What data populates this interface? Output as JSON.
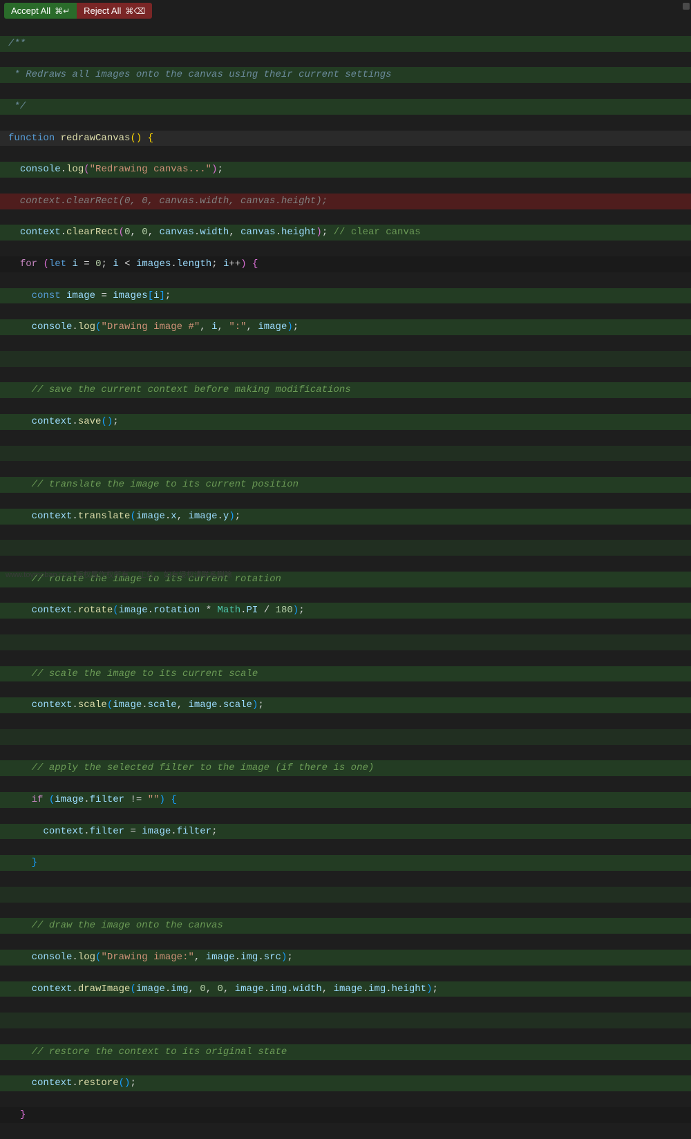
{
  "toolbar": {
    "accept_label": "Accept All",
    "accept_shortcut": "⌘↵",
    "reject_label": "Reject All",
    "reject_shortcut": "⌘⌫"
  },
  "code": {
    "l1": "/**",
    "l2": " * Redraws all images onto the canvas using their current settings",
    "l3": " */",
    "l4_kw": "function",
    "l4_fn": "redrawCanvas",
    "l5_obj": "console",
    "l5_fn": "log",
    "l5_str": "\"Redrawing canvas...\"",
    "l6_full": "  context.clearRect(0, 0, canvas.width, canvas.height);",
    "l7_ctx": "context",
    "l7_fn": "clearRect",
    "l7_n0": "0",
    "l7_n1": "0",
    "l7_cw": "canvas",
    "l7_w": "width",
    "l7_ch": "canvas",
    "l7_h": "height",
    "l7_cm": "// clear canvas",
    "l8_for": "for",
    "l8_let": "let",
    "l8_i": "i",
    "l8_0": "0",
    "l8_images": "images",
    "l8_len": "length",
    "l9_const": "const",
    "l9_image": "image",
    "l9_images": "images",
    "l9_i": "i",
    "l10_obj": "console",
    "l10_fn": "log",
    "l10_str1": "\"Drawing image #\"",
    "l10_i": "i",
    "l10_str2": "\":\"",
    "l10_image": "image",
    "l12_cm": "// save the current context before making modifications",
    "l13_ctx": "context",
    "l13_fn": "save",
    "l15_cm": "// translate the image to its current position",
    "l16_ctx": "context",
    "l16_fn": "translate",
    "l16_img": "image",
    "l16_x": "x",
    "l16_img2": "image",
    "l16_y": "y",
    "l18_cm": "// rotate the image to its current rotation",
    "l19_ctx": "context",
    "l19_fn": "rotate",
    "l19_img": "image",
    "l19_rot": "rotation",
    "l19_math": "Math",
    "l19_pi": "PI",
    "l19_180": "180",
    "l21_cm": "// scale the image to its current scale",
    "l22_ctx": "context",
    "l22_fn": "scale",
    "l22_img": "image",
    "l22_s": "scale",
    "l22_img2": "image",
    "l22_s2": "scale",
    "l24_cm": "// apply the selected filter to the image (if there is one)",
    "l25_if": "if",
    "l25_img": "image",
    "l25_flt": "filter",
    "l25_str": "\"\"",
    "l26_ctx": "context",
    "l26_flt": "filter",
    "l26_img": "image",
    "l26_flt2": "filter",
    "l29_cm": "// draw the image onto the canvas",
    "l30_obj": "console",
    "l30_fn": "log",
    "l30_str": "\"Drawing image:\"",
    "l30_img": "image",
    "l30_im": "img",
    "l30_src": "src",
    "l31_ctx": "context",
    "l31_fn": "drawImage",
    "l31_img": "image",
    "l31_im": "img",
    "l31_0a": "0",
    "l31_0b": "0",
    "l31_img2": "image",
    "l31_im2": "img",
    "l31_w": "width",
    "l31_img3": "image",
    "l31_im3": "img",
    "l31_h": "height",
    "l33_cm": "// restore the context to its original state",
    "l34_ctx": "context",
    "l34_fn": "restore"
  },
  "watermark": "www.toymoban.com 版权属作权所有 ，正软。 如有侵权请联系删除"
}
